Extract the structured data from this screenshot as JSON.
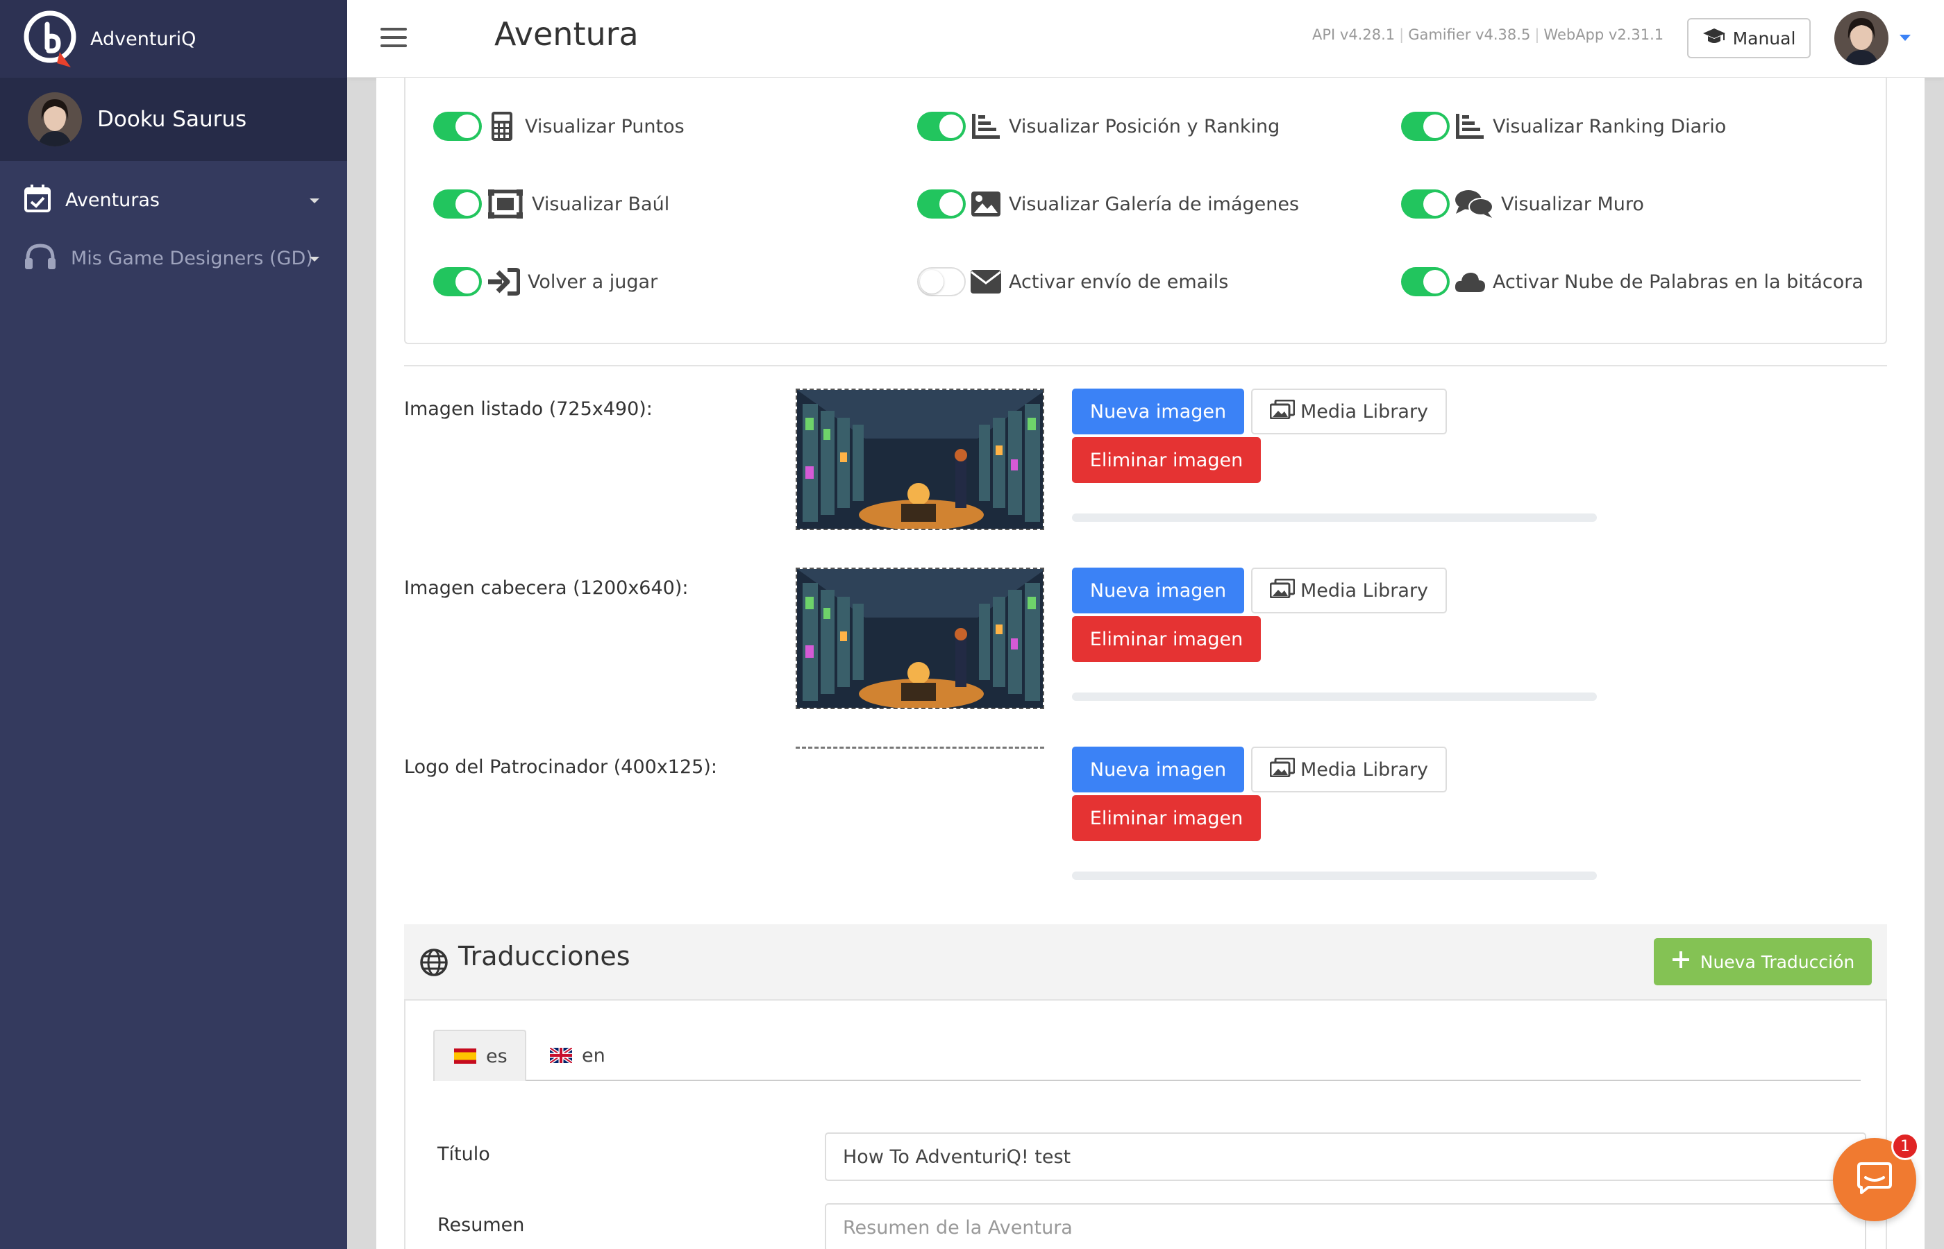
{
  "app": {
    "brand": "AdventuriQ",
    "user_name": "Dooku Saurus",
    "page_title": "Aventura"
  },
  "sidebar": {
    "items": [
      {
        "label": "Aventuras",
        "icon": "calendar-check-icon"
      },
      {
        "label": "Mis Game Designers (GD)",
        "icon": "headphones-icon"
      }
    ]
  },
  "topbar": {
    "versions": [
      "API v4.28.1",
      "Gamifier v4.38.5",
      "WebApp v2.31.1"
    ],
    "manual_label": "Manual"
  },
  "options": [
    {
      "label": "Visualizar Puntos",
      "enabled": true,
      "icon": "calculator-icon"
    },
    {
      "label": "Visualizar Posición y Ranking",
      "enabled": true,
      "icon": "bar-chart-icon"
    },
    {
      "label": "Visualizar Ranking Diario",
      "enabled": true,
      "icon": "bar-chart-icon"
    },
    {
      "label": "Visualizar Baúl",
      "enabled": true,
      "icon": "chest-icon"
    },
    {
      "label": "Visualizar Galería de imágenes",
      "enabled": true,
      "icon": "image-icon"
    },
    {
      "label": "Visualizar Muro",
      "enabled": true,
      "icon": "comments-icon"
    },
    {
      "label": "Volver a jugar",
      "enabled": true,
      "icon": "sign-in-icon"
    },
    {
      "label": "Activar envío de emails",
      "enabled": false,
      "icon": "envelope-icon"
    },
    {
      "label": "Activar Nube de Palabras en la bitácora",
      "enabled": true,
      "icon": "cloud-icon"
    }
  ],
  "images": [
    {
      "label": "Imagen listado (725x490):",
      "has_image": true
    },
    {
      "label": "Imagen cabecera (1200x640):",
      "has_image": true
    },
    {
      "label": "Logo del Patrocinador (400x125):",
      "has_image": false
    }
  ],
  "image_buttons": {
    "new": "Nueva imagen",
    "library": "Media Library",
    "delete": "Eliminar imagen"
  },
  "translations": {
    "title": "Traducciones",
    "new_button": "Nueva Traducción",
    "tabs": [
      {
        "label": "es",
        "active": true
      },
      {
        "label": "en",
        "active": false
      }
    ],
    "fields": {
      "title_label": "Título",
      "title_value": "How To AdventuriQ! test",
      "summary_label": "Resumen",
      "summary_placeholder": "Resumen de la Aventura"
    }
  },
  "chat": {
    "badge_count": "1"
  },
  "colors": {
    "sidebar": "#343a5e",
    "toggle_on": "#22c55e",
    "primary": "#3b82f6",
    "danger": "#e53333",
    "success": "#84c254",
    "chat": "#f07a30"
  }
}
